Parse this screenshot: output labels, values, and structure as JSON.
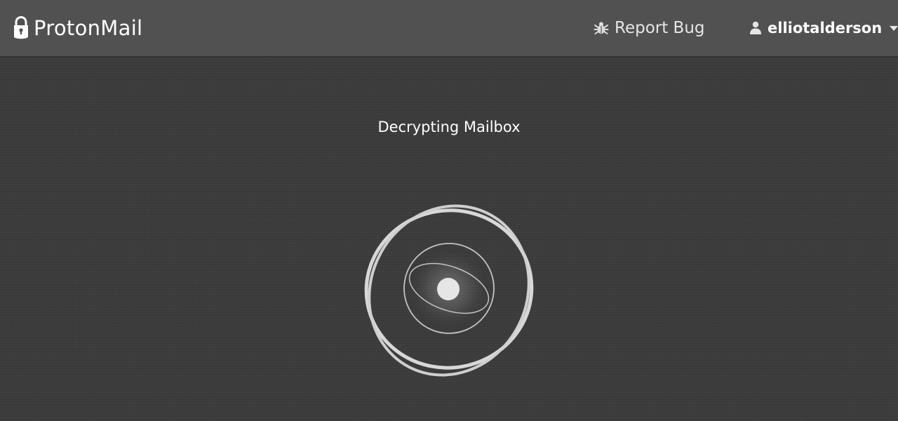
{
  "header": {
    "brand": "ProtonMail",
    "report_bug_label": "Report Bug",
    "username": "elliotalderson"
  },
  "main": {
    "status": "Decrypting Mailbox"
  },
  "icons": {
    "brand_logo": "lock-icon",
    "report_bug": "bug-icon",
    "user": "user-icon",
    "dropdown": "caret-down-icon",
    "loader": "atom-loader-icon"
  },
  "colors": {
    "topbar": "#515151",
    "background": "#3a3a3a",
    "text": "#ffffff",
    "secondary_text": "#e6e6e6",
    "loader_stroke": "#d9d9d9"
  }
}
